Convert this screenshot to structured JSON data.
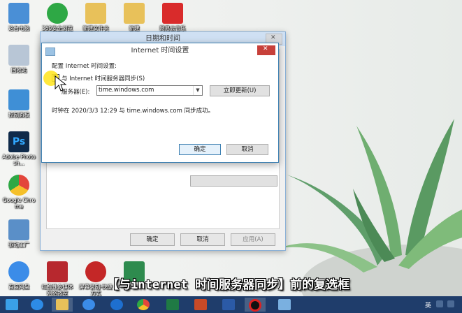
{
  "desktop_icons": [
    {
      "label": "这台电脑",
      "color": "#4a8fd6"
    },
    {
      "label": "360安全浏览器",
      "color": "#2ea845"
    },
    {
      "label": "新建文件夹",
      "color": "#e8c15a"
    },
    {
      "label": "新建",
      "color": "#e8c15a"
    },
    {
      "label": "网易云音乐",
      "color": "#d92b2b"
    },
    {
      "label": "回收站",
      "color": "#b8c6d6"
    },
    {
      "label": "控制面板",
      "color": "#3f8fd6"
    },
    {
      "label": "Adobe Photosh...",
      "color": "#0f2a4a"
    },
    {
      "label": "Google Chrome",
      "color": "#e3463b"
    },
    {
      "label": "驱动工厂",
      "color": "#5a8fc8"
    },
    {
      "label": "百度网盘",
      "color": "#3b8ce8"
    },
    {
      "label": "红蜘蛛多媒体网络教室",
      "color": "#b7282e"
    },
    {
      "label": "屏幕录制-快捷方式",
      "color": "#c42727"
    },
    {
      "label": "xlsx",
      "color": "#2e8b4e"
    }
  ],
  "outer_window": {
    "title": "日期和时间",
    "ok": "确定",
    "cancel": "取消",
    "apply": "应用(A)"
  },
  "inner_window": {
    "title": "Internet 时间设置",
    "config_label": "配置 Internet 时间设置:",
    "sync_checkbox_label": "与 Internet 时间服务器同步(S)",
    "server_label": "服务器(E):",
    "server_value": "time.windows.com",
    "update_now": "立即更新(U)",
    "status": "时钟在 2020/3/3 12:29 与 time.windows.com 同步成功。",
    "ok": "确定",
    "cancel": "取消"
  },
  "caption": "【与internet 时间服务器同步】前的复选框",
  "taskbar": {
    "items": [
      "windows-start",
      "ie",
      "file-explorer",
      "baidu-netdisk",
      "ie-blue",
      "chrome",
      "excel",
      "powerpoint",
      "word",
      "screen-recorder",
      "control-panel"
    ],
    "tray_text": "英"
  },
  "colors": {
    "taskbar": "#1f3d6b",
    "close_red": "#c7403a",
    "highlight_yellow": "#ffe628"
  }
}
